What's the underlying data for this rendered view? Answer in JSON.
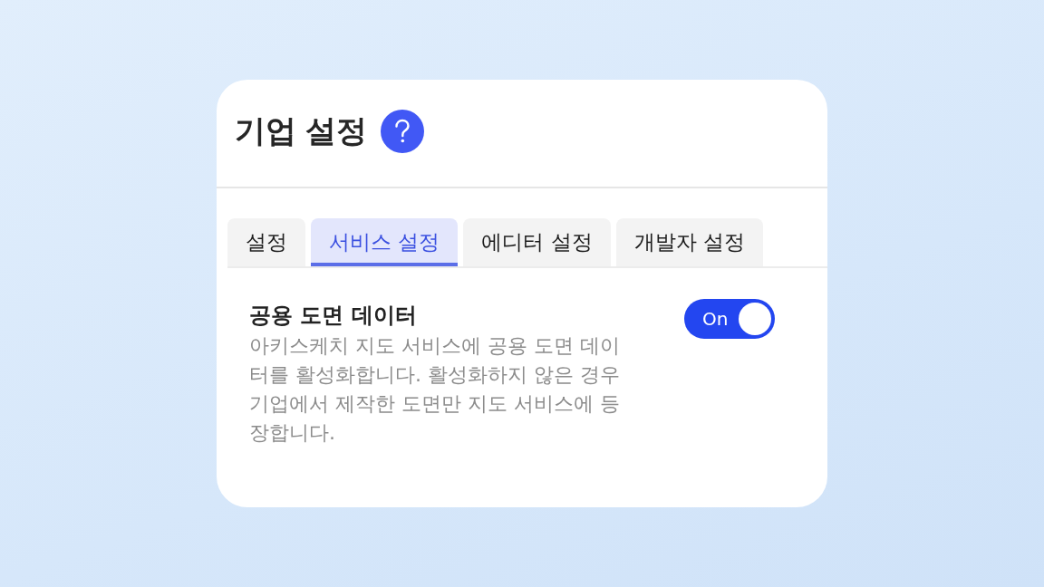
{
  "card": {
    "title": "기업 설정",
    "tabs": [
      {
        "label": "설정",
        "selected": false
      },
      {
        "label": "서비스 설정",
        "selected": true
      },
      {
        "label": "에디터 설정",
        "selected": false
      },
      {
        "label": "개발자 설정",
        "selected": false
      }
    ],
    "settings": [
      {
        "title": "공용 도면 데이터",
        "description": "아키스케치 지도 서비스에 공용 도면 데이터를 활성화합니다. 활성화하지 않은 경우 기업에서 제작한 도면만 지도 서비스에 등장합니다.",
        "toggle": {
          "label": "On",
          "on": true
        }
      }
    ]
  }
}
